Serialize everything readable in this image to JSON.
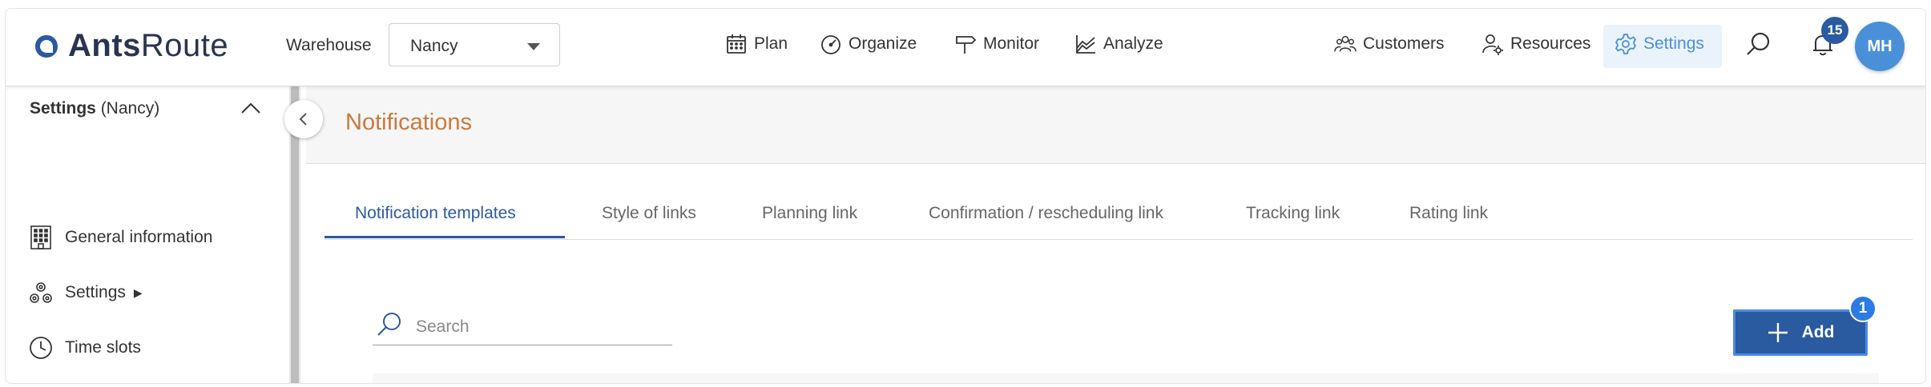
{
  "app": {
    "brand_bold": "Ants",
    "brand_light": "Route"
  },
  "header": {
    "warehouse_label": "Warehouse",
    "warehouse_value": "Nancy",
    "nav": {
      "plan": "Plan",
      "organize": "Organize",
      "monitor": "Monitor",
      "analyze": "Analyze",
      "customers": "Customers",
      "resources": "Resources",
      "settings": "Settings"
    },
    "notifications_count": "15",
    "avatar_initials": "MH"
  },
  "sidebar": {
    "section_title": "Settings",
    "section_context": "(Nancy)",
    "items": [
      {
        "label": "General information",
        "icon": "building-icon"
      },
      {
        "label": "Settings",
        "icon": "cogs-icon",
        "has_submenu": true,
        "arrow": "▶"
      },
      {
        "label": "Time slots",
        "icon": "clock-icon"
      }
    ]
  },
  "page": {
    "title": "Notifications",
    "tabs": [
      {
        "label": "Notification templates",
        "active": true
      },
      {
        "label": "Style of links"
      },
      {
        "label": "Planning link"
      },
      {
        "label": "Confirmation / rescheduling link"
      },
      {
        "label": "Tracking link"
      },
      {
        "label": "Rating link"
      }
    ],
    "search": {
      "placeholder": "Search",
      "value": ""
    },
    "add_label": "Add",
    "add_badge": "1"
  },
  "colors": {
    "accent": "#2a5aa0",
    "settings_active": "#4a90d9",
    "title": "#c97a3d"
  }
}
